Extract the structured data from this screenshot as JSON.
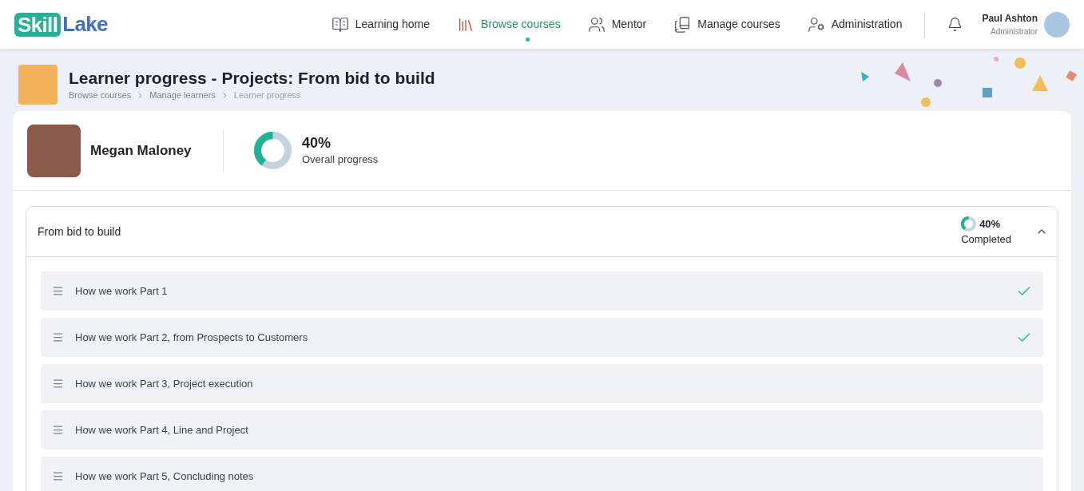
{
  "logo": {
    "part_1": "Skill",
    "part_2": "Lake"
  },
  "nav": [
    {
      "label": "Learning home",
      "kind": "home",
      "selected": false
    },
    {
      "label": "Browse courses",
      "kind": "browse",
      "selected": true
    },
    {
      "label": "Mentor",
      "kind": "mentor",
      "selected": false
    },
    {
      "label": "Manage courses",
      "kind": "manage",
      "selected": false
    },
    {
      "label": "Administration",
      "kind": "admin",
      "selected": false
    }
  ],
  "user": {
    "name": "Paul Ashton",
    "role": "Administrator"
  },
  "page": {
    "title": "Learner progress - Projects: From bid to build",
    "breadcrumbs": [
      "Browse courses",
      "Manage learners",
      "Learner progress"
    ]
  },
  "learner": {
    "name": "Megan Maloney",
    "progress": {
      "level": 0.4,
      "value": "40%",
      "label": "Overall progress"
    }
  },
  "course": {
    "title": "From bid to build",
    "expanded": true,
    "progress": {
      "level": 0.4,
      "value": "40%",
      "label": "Completed"
    },
    "lessons": [
      {
        "title": "How we work Part 1",
        "completed": true
      },
      {
        "title": "How we work Part 2, from Prospects to Customers",
        "completed": true
      },
      {
        "title": "How we work Part 3, Project execution",
        "completed": false
      },
      {
        "title": "How we work Part 4, Line and Project",
        "completed": false
      },
      {
        "title": "How we work Part 5, Concluding notes",
        "completed": false
      }
    ]
  }
}
